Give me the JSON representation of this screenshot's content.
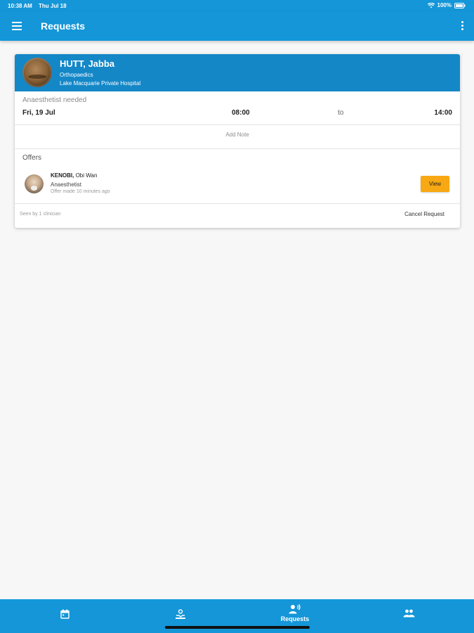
{
  "status_bar": {
    "time": "10:38 AM",
    "date": "Thu Jul 18",
    "battery": "100%"
  },
  "app_bar": {
    "title": "Requests",
    "menu_icon": "hamburger-menu-icon",
    "more_icon": "more-vertical-icon"
  },
  "request": {
    "patient_name": "HUTT, Jabba",
    "specialty": "Orthopaedics",
    "hospital": "Lake Macquarie Private Hospital",
    "needed": "Anaesthetist needed",
    "date": "Fri, 19 Jul",
    "start": "08:00",
    "to": "to",
    "end": "14:00",
    "add_note": "Add Note",
    "offers_label": "Offers",
    "offer": {
      "surname": "KENOBI,",
      "first_name": "Obi Wan",
      "role": "Anaesthetist",
      "time": "Offer made 10 minutes ago",
      "view_label": "View"
    },
    "seen": "Seen by 1 clinician",
    "cancel_label": "Cancel Request"
  },
  "bottom_nav": [
    {
      "icon": "calendar-icon",
      "label": ""
    },
    {
      "icon": "hand-request-icon",
      "label": ""
    },
    {
      "icon": "person-speaking-icon",
      "label": "Requests",
      "active": true
    },
    {
      "icon": "people-icon",
      "label": ""
    }
  ],
  "colors": {
    "primary": "#1496d8",
    "header": "#1487c7",
    "accent": "#f8a812"
  }
}
